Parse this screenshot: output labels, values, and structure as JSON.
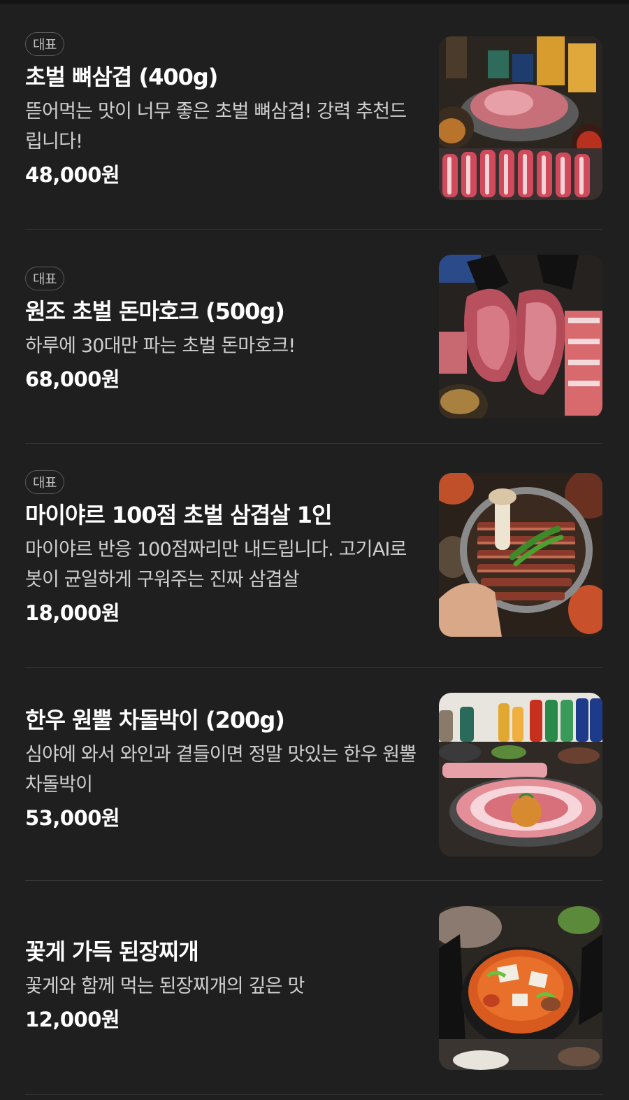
{
  "menu": {
    "items": [
      {
        "badge": "대표",
        "name": "초벌 뼈삼겹 (400g)",
        "description": "뜯어먹는 맛이 너무 좋은 초벌 뼈삼겹! 강력 추천드립니다!",
        "price": "48,000원",
        "image": "grilled-pork-belly-bone-photo"
      },
      {
        "badge": "대표",
        "name": "원조 초벌 돈마호크 (500g)",
        "description": "하루에 30대만 파는 초벌 돈마호크!",
        "price": "68,000원",
        "image": "tomahawk-pork-photo"
      },
      {
        "badge": "대표",
        "name": "마이야르 100점 초벌 삼겹살 1인",
        "description": "마이야르 반응 100점짜리만 내드립니다. 고기AI로봇이 균일하게 구워주는 진짜 삼겹살",
        "price": "18,000원",
        "image": "grilled-pork-belly-platter-photo"
      },
      {
        "name": "한우 원뿔 차돌박이 (200g)",
        "description": "심야에 와서 와인과 곁들이면 정말 맛있는 한우 원뿔 차돌박이",
        "price": "53,000원",
        "image": "beef-brisket-photo"
      },
      {
        "name": "꽃게 가득 된장찌개",
        "description": "꽃게와 함께 먹는 된장찌개의 깊은 맛",
        "price": "12,000원",
        "image": "crab-doenjang-stew-photo"
      }
    ]
  }
}
